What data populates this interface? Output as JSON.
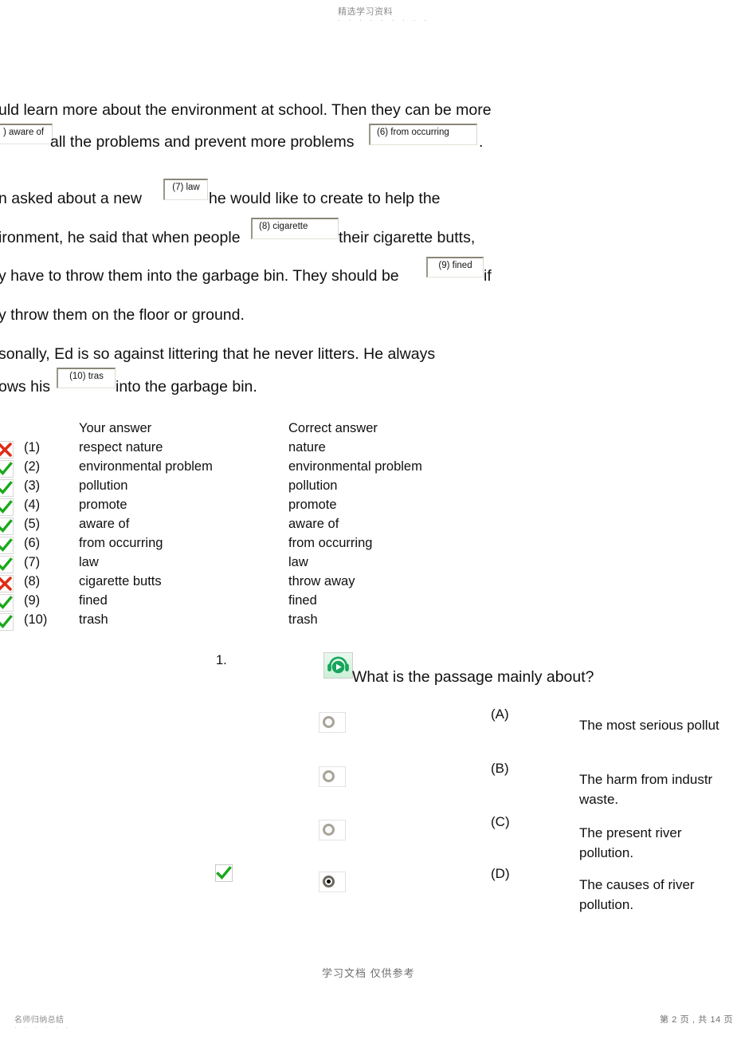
{
  "watermarks": {
    "top": "精选学习资料",
    "top_dots": "· · · · · · · · ·",
    "middle": "学习文档   仅供参考",
    "bottom_left": "名师归纳总结",
    "bottom_left_dots": "· · · · · ·",
    "bottom_right": "第 2 页 , 共 14 页"
  },
  "passage": {
    "lines": [
      "uld learn more about the environment at school. Then they can be more",
      "all the problems and prevent more problems",
      ".",
      "n  asked  about  a  new",
      "he  would  like   to   create   to  help   the",
      "ironment, he said that when people",
      "their cigarette butts,",
      "y have to throw them into the garbage bin. They should be",
      "if",
      "y throw them on the floor or ground.",
      "sonally, Ed is so against littering that he never litters. He always",
      "ows his",
      "into the garbage bin."
    ],
    "boxes": [
      {
        "label": ") aware of"
      },
      {
        "label": "(6) from occurring"
      },
      {
        "label": "(7) law"
      },
      {
        "label": "(8) cigarette"
      },
      {
        "label": "(9) fined"
      },
      {
        "label": "(10) tras"
      }
    ]
  },
  "results": {
    "header_your": "Your answer",
    "header_correct": "Correct answer",
    "rows": [
      {
        "num": "(1)",
        "your": "respect nature",
        "correct": "nature",
        "status": "wrong"
      },
      {
        "num": "(2)",
        "your": "environmental problem",
        "correct": "environmental problem",
        "status": "right"
      },
      {
        "num": "(3)",
        "your": "pollution",
        "correct": "pollution",
        "status": "right"
      },
      {
        "num": "(4)",
        "your": "promote",
        "correct": "promote",
        "status": "right"
      },
      {
        "num": "(5)",
        "your": "aware of",
        "correct": "aware of",
        "status": "right"
      },
      {
        "num": "(6)",
        "your": "from occurring",
        "correct": "from occurring",
        "status": "right"
      },
      {
        "num": "(7)",
        "your": "law",
        "correct": "law",
        "status": "right"
      },
      {
        "num": "(8)",
        "your": "cigarette butts",
        "correct": "throw away",
        "status": "wrong"
      },
      {
        "num": "(9)",
        "your": "fined",
        "correct": "fined",
        "status": "right"
      },
      {
        "num": "(10)",
        "your": "trash",
        "correct": "trash",
        "status": "right"
      }
    ]
  },
  "question": {
    "number": "1.",
    "audio_icon": "audio-play-headphones-icon",
    "text": "What is the passage mainly about?",
    "options": [
      {
        "letter": "(A)",
        "text": "The most serious   pollut",
        "selected": false,
        "correct": false
      },
      {
        "letter": "(B)",
        "text": "The harm from industr waste.",
        "selected": false,
        "correct": false
      },
      {
        "letter": "(C)",
        "text": "The present river pollution.",
        "selected": false,
        "correct": false
      },
      {
        "letter": "(D)",
        "text": "The causes of river pollution.",
        "selected": true,
        "correct": true
      }
    ]
  },
  "colors": {
    "correct_green": "#1aa81a",
    "wrong_red": "#e02b16",
    "audio_green": "#17a55c"
  }
}
